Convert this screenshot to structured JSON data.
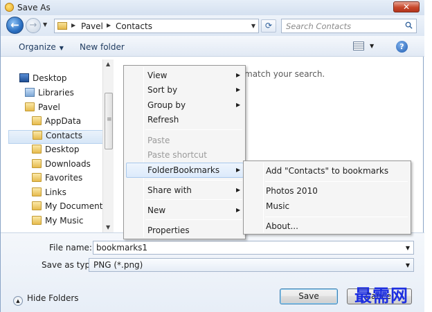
{
  "window": {
    "title": "Save As",
    "close_label": "✕"
  },
  "navbar": {
    "breadcrumb": [
      "Pavel",
      "Contacts"
    ],
    "search_placeholder": "Search Contacts"
  },
  "toolbar": {
    "organize_label": "Organize",
    "new_folder_label": "New folder",
    "help_label": "?"
  },
  "sidebar": {
    "items": [
      {
        "label": "Desktop",
        "icon": "desktop-icon"
      },
      {
        "label": "Libraries",
        "icon": "libraries-icon"
      },
      {
        "label": "Pavel",
        "icon": "folder-icon"
      },
      {
        "label": "AppData",
        "icon": "folder-icon"
      },
      {
        "label": "Contacts",
        "icon": "contacts-folder-icon",
        "selected": true
      },
      {
        "label": "Desktop",
        "icon": "folder-icon"
      },
      {
        "label": "Downloads",
        "icon": "folder-icon"
      },
      {
        "label": "Favorites",
        "icon": "folder-icon"
      },
      {
        "label": "Links",
        "icon": "folder-icon"
      },
      {
        "label": "My Documents",
        "icon": "folder-icon"
      },
      {
        "label": "My Music",
        "icon": "folder-icon"
      }
    ]
  },
  "content": {
    "empty_message": "match your search."
  },
  "context_menu": {
    "items": [
      "View",
      "Sort by",
      "Group by",
      "Refresh",
      "Paste",
      "Paste shortcut",
      "FolderBookmarks",
      "Share with",
      "New",
      "Properties"
    ]
  },
  "submenu": {
    "items": [
      "Add \"Contacts\" to bookmarks",
      "Photos 2010",
      "Music",
      "About..."
    ]
  },
  "form": {
    "file_name_label": "File name:",
    "file_name_value": "bookmarks1",
    "save_type_label": "Save as type:",
    "save_type_value": "PNG (*.png)",
    "hide_folders_label": "Hide Folders",
    "save_label": "Save",
    "cancel_label": "Cancel"
  },
  "watermark": "最需网",
  "colors": {
    "accent": "#3c7fb1",
    "watermark": "#1d2fe0",
    "close": "#c7472b"
  }
}
